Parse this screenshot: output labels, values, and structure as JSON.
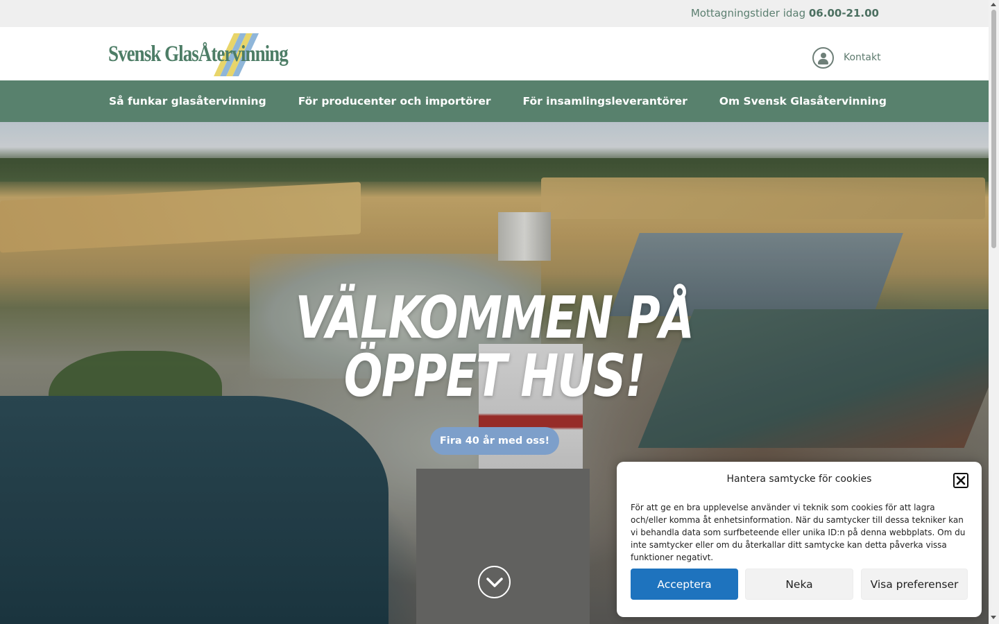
{
  "topbar": {
    "hours_prefix": "Mottagningstider idag",
    "hours_value": "06.00-21.00"
  },
  "header": {
    "logo_text": "Svensk GlasÅtervinning",
    "contact_label": "Kontakt",
    "contact_icon": "user-icon"
  },
  "nav": {
    "items": [
      {
        "label": "Så funkar glasåtervinning"
      },
      {
        "label": "För producenter och importörer"
      },
      {
        "label": "För insamlingsleverantörer"
      },
      {
        "label": "Om Svensk Glasåtervinning"
      }
    ]
  },
  "hero": {
    "headline_line1": "VÄLKOMMEN PÅ",
    "headline_line2": "ÖPPET HUS!",
    "cta_label": "Fira 40 år med oss!",
    "scroll_icon": "chevron-down-icon"
  },
  "cookie": {
    "title": "Hantera samtycke för cookies",
    "body": "För att ge en bra upplevelse använder vi teknik som cookies för att lagra och/eller komma åt enhetsinformation. När du samtycker till dessa tekniker kan vi behandla data som surfbeteende eller unika ID:n på denna webbplats. Om du inte samtycker eller om du återkallar ditt samtycke kan detta påverka vissa funktioner negativt.",
    "accept_label": "Acceptera",
    "deny_label": "Neka",
    "prefs_label": "Visa preferenser",
    "close_icon": "close-icon"
  },
  "colors": {
    "nav_bg": "#58816d",
    "cta_bg": "#7d9fca",
    "accept_bg": "#1e73be",
    "logo_green": "#4d7d66",
    "logo_stripe_yellow": "#e8d56a",
    "logo_stripe_blue": "#8fb6d9"
  }
}
